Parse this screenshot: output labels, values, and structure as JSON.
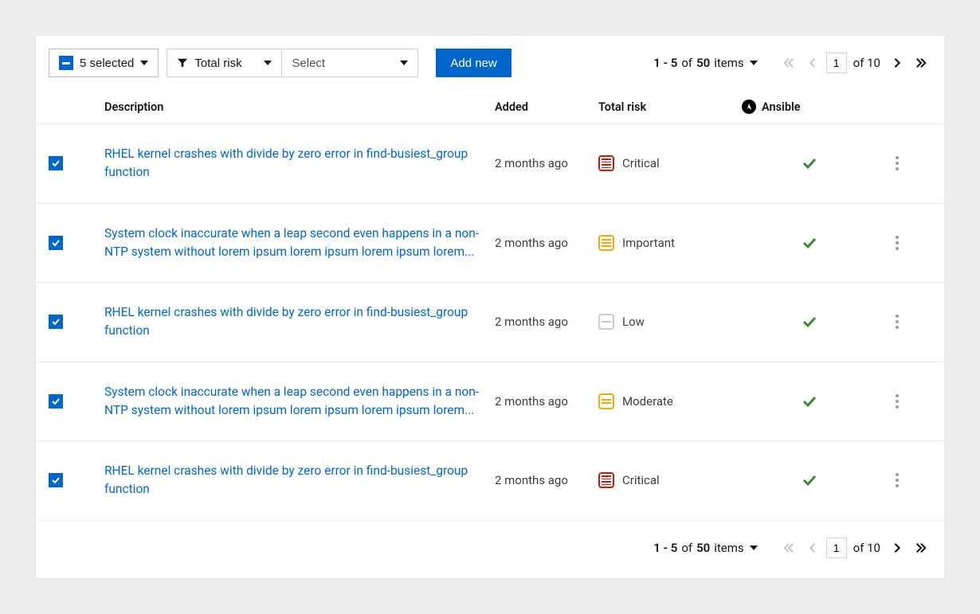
{
  "toolbar": {
    "selection_label": "5 selected",
    "filter_label": "Total risk",
    "select_placeholder": "Select",
    "add_button": "Add new"
  },
  "pagination": {
    "range": "1 - 5",
    "of_word": "of",
    "total": "50",
    "items_word": "items",
    "page_input": "1",
    "pages_total": "of 10"
  },
  "headers": {
    "description": "Description",
    "added": "Added",
    "total_risk": "Total risk",
    "ansible": "Ansible"
  },
  "rows": [
    {
      "checked": true,
      "description": "RHEL kernel crashes with divide by zero error in find-busiest_group function",
      "added": "2 months ago",
      "risk_level": "Critical",
      "risk_class": "critical",
      "ansible": true
    },
    {
      "checked": true,
      "description": "System clock inaccurate when a leap second even happens in a non-NTP system without lorem ipsum lorem ipsum lorem ipsum lorem...",
      "added": "2 months ago",
      "risk_level": "Important",
      "risk_class": "important",
      "ansible": true
    },
    {
      "checked": true,
      "description": "RHEL kernel crashes with divide by zero error in find-busiest_group function",
      "added": "2 months ago",
      "risk_level": "Low",
      "risk_class": "low",
      "ansible": true
    },
    {
      "checked": true,
      "description": "System clock inaccurate when a leap second even happens in a non-NTP system without lorem ipsum lorem ipsum lorem ipsum lorem...",
      "added": "2 months ago",
      "risk_level": "Moderate",
      "risk_class": "moderate",
      "ansible": true
    },
    {
      "checked": true,
      "description": "RHEL kernel crashes with divide by zero error in find-busiest_group function",
      "added": "2 months ago",
      "risk_level": "Critical",
      "risk_class": "critical",
      "ansible": true
    }
  ]
}
